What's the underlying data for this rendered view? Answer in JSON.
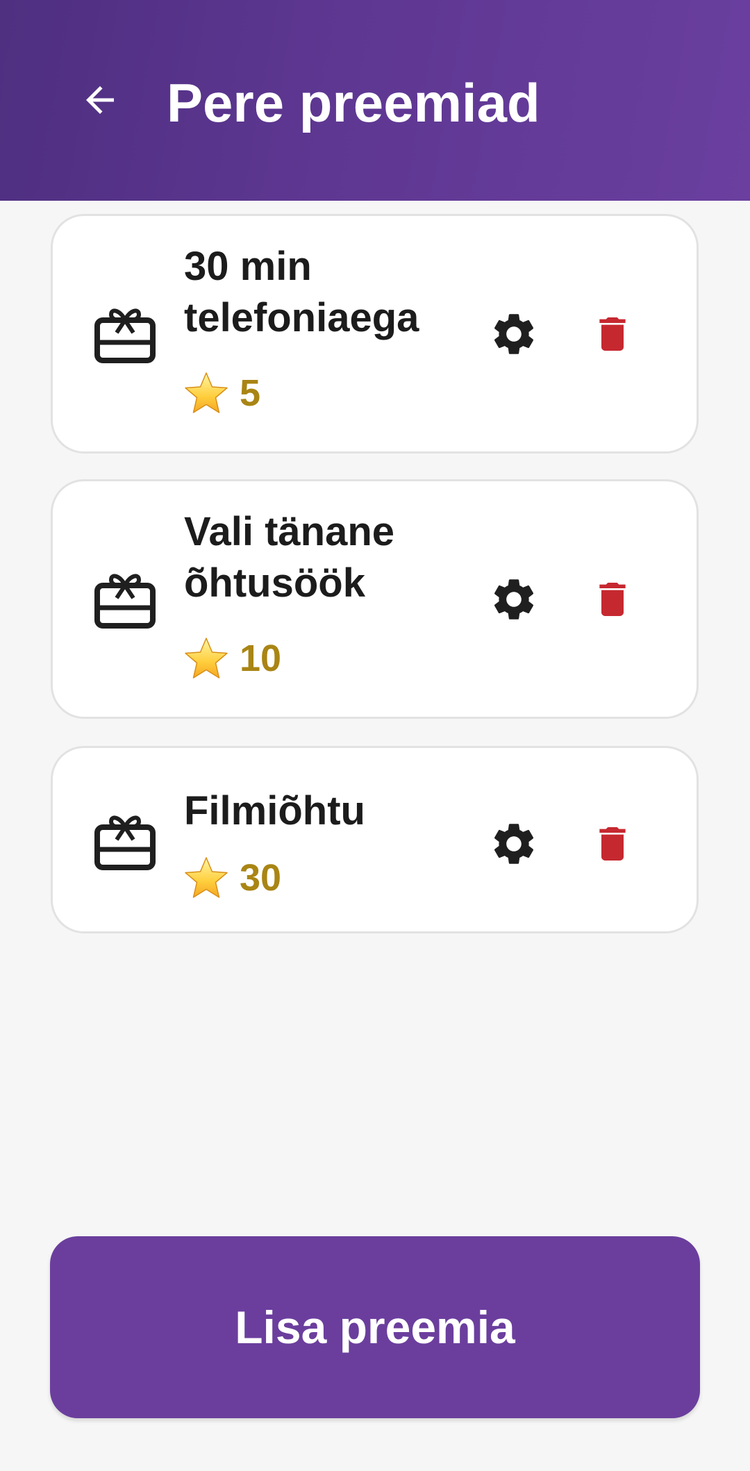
{
  "app_bar": {
    "title": "Pere preemiad",
    "back_icon": "arrow-left-icon",
    "background_colors": [
      "#4e2f80",
      "#6a3f9f"
    ]
  },
  "rewards": [
    {
      "title": "30 min telefoniaega",
      "cost": "5",
      "icon": "gift-card-icon"
    },
    {
      "title": "Vali tänane õhtusöök",
      "cost": "10",
      "icon": "gift-card-icon"
    },
    {
      "title": "Filmiõhtu",
      "cost": "30",
      "icon": "gift-card-icon"
    }
  ],
  "actions": {
    "settings_icon": "gear-icon",
    "delete_icon": "trash-icon",
    "delete_color": "#c62830"
  },
  "add_button": {
    "label": "Lisa preemia",
    "color": "#6b3e9d"
  },
  "colors": {
    "cost_text": "#a98514",
    "page_background": "#f6f6f6"
  }
}
